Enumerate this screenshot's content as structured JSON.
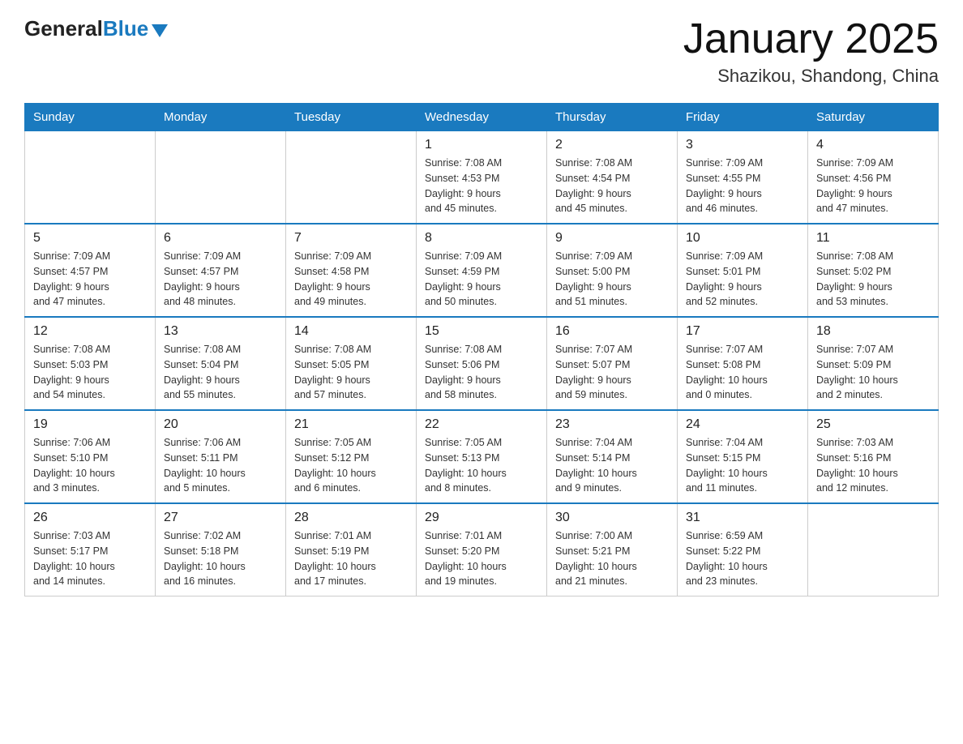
{
  "header": {
    "logo_general": "General",
    "logo_blue": "Blue",
    "title": "January 2025",
    "subtitle": "Shazikou, Shandong, China"
  },
  "days_of_week": [
    "Sunday",
    "Monday",
    "Tuesday",
    "Wednesday",
    "Thursday",
    "Friday",
    "Saturday"
  ],
  "weeks": [
    [
      {
        "day": "",
        "info": ""
      },
      {
        "day": "",
        "info": ""
      },
      {
        "day": "",
        "info": ""
      },
      {
        "day": "1",
        "info": "Sunrise: 7:08 AM\nSunset: 4:53 PM\nDaylight: 9 hours\nand 45 minutes."
      },
      {
        "day": "2",
        "info": "Sunrise: 7:08 AM\nSunset: 4:54 PM\nDaylight: 9 hours\nand 45 minutes."
      },
      {
        "day": "3",
        "info": "Sunrise: 7:09 AM\nSunset: 4:55 PM\nDaylight: 9 hours\nand 46 minutes."
      },
      {
        "day": "4",
        "info": "Sunrise: 7:09 AM\nSunset: 4:56 PM\nDaylight: 9 hours\nand 47 minutes."
      }
    ],
    [
      {
        "day": "5",
        "info": "Sunrise: 7:09 AM\nSunset: 4:57 PM\nDaylight: 9 hours\nand 47 minutes."
      },
      {
        "day": "6",
        "info": "Sunrise: 7:09 AM\nSunset: 4:57 PM\nDaylight: 9 hours\nand 48 minutes."
      },
      {
        "day": "7",
        "info": "Sunrise: 7:09 AM\nSunset: 4:58 PM\nDaylight: 9 hours\nand 49 minutes."
      },
      {
        "day": "8",
        "info": "Sunrise: 7:09 AM\nSunset: 4:59 PM\nDaylight: 9 hours\nand 50 minutes."
      },
      {
        "day": "9",
        "info": "Sunrise: 7:09 AM\nSunset: 5:00 PM\nDaylight: 9 hours\nand 51 minutes."
      },
      {
        "day": "10",
        "info": "Sunrise: 7:09 AM\nSunset: 5:01 PM\nDaylight: 9 hours\nand 52 minutes."
      },
      {
        "day": "11",
        "info": "Sunrise: 7:08 AM\nSunset: 5:02 PM\nDaylight: 9 hours\nand 53 minutes."
      }
    ],
    [
      {
        "day": "12",
        "info": "Sunrise: 7:08 AM\nSunset: 5:03 PM\nDaylight: 9 hours\nand 54 minutes."
      },
      {
        "day": "13",
        "info": "Sunrise: 7:08 AM\nSunset: 5:04 PM\nDaylight: 9 hours\nand 55 minutes."
      },
      {
        "day": "14",
        "info": "Sunrise: 7:08 AM\nSunset: 5:05 PM\nDaylight: 9 hours\nand 57 minutes."
      },
      {
        "day": "15",
        "info": "Sunrise: 7:08 AM\nSunset: 5:06 PM\nDaylight: 9 hours\nand 58 minutes."
      },
      {
        "day": "16",
        "info": "Sunrise: 7:07 AM\nSunset: 5:07 PM\nDaylight: 9 hours\nand 59 minutes."
      },
      {
        "day": "17",
        "info": "Sunrise: 7:07 AM\nSunset: 5:08 PM\nDaylight: 10 hours\nand 0 minutes."
      },
      {
        "day": "18",
        "info": "Sunrise: 7:07 AM\nSunset: 5:09 PM\nDaylight: 10 hours\nand 2 minutes."
      }
    ],
    [
      {
        "day": "19",
        "info": "Sunrise: 7:06 AM\nSunset: 5:10 PM\nDaylight: 10 hours\nand 3 minutes."
      },
      {
        "day": "20",
        "info": "Sunrise: 7:06 AM\nSunset: 5:11 PM\nDaylight: 10 hours\nand 5 minutes."
      },
      {
        "day": "21",
        "info": "Sunrise: 7:05 AM\nSunset: 5:12 PM\nDaylight: 10 hours\nand 6 minutes."
      },
      {
        "day": "22",
        "info": "Sunrise: 7:05 AM\nSunset: 5:13 PM\nDaylight: 10 hours\nand 8 minutes."
      },
      {
        "day": "23",
        "info": "Sunrise: 7:04 AM\nSunset: 5:14 PM\nDaylight: 10 hours\nand 9 minutes."
      },
      {
        "day": "24",
        "info": "Sunrise: 7:04 AM\nSunset: 5:15 PM\nDaylight: 10 hours\nand 11 minutes."
      },
      {
        "day": "25",
        "info": "Sunrise: 7:03 AM\nSunset: 5:16 PM\nDaylight: 10 hours\nand 12 minutes."
      }
    ],
    [
      {
        "day": "26",
        "info": "Sunrise: 7:03 AM\nSunset: 5:17 PM\nDaylight: 10 hours\nand 14 minutes."
      },
      {
        "day": "27",
        "info": "Sunrise: 7:02 AM\nSunset: 5:18 PM\nDaylight: 10 hours\nand 16 minutes."
      },
      {
        "day": "28",
        "info": "Sunrise: 7:01 AM\nSunset: 5:19 PM\nDaylight: 10 hours\nand 17 minutes."
      },
      {
        "day": "29",
        "info": "Sunrise: 7:01 AM\nSunset: 5:20 PM\nDaylight: 10 hours\nand 19 minutes."
      },
      {
        "day": "30",
        "info": "Sunrise: 7:00 AM\nSunset: 5:21 PM\nDaylight: 10 hours\nand 21 minutes."
      },
      {
        "day": "31",
        "info": "Sunrise: 6:59 AM\nSunset: 5:22 PM\nDaylight: 10 hours\nand 23 minutes."
      },
      {
        "day": "",
        "info": ""
      }
    ]
  ]
}
